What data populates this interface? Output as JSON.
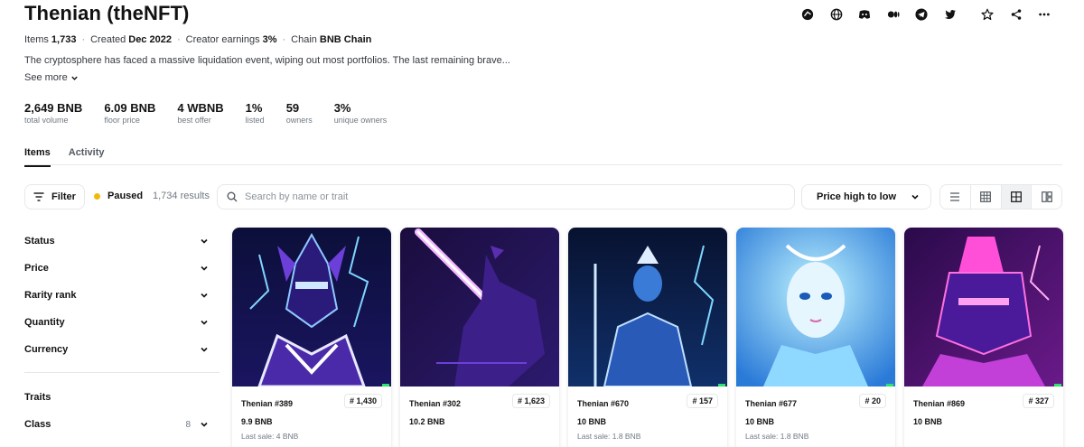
{
  "collection": {
    "title": "Thenian (theNFT)",
    "meta": [
      {
        "label": "Items",
        "value": "1,733"
      },
      {
        "label": "Created",
        "value": "Dec 2022"
      },
      {
        "label": "Creator earnings",
        "value": "3%"
      },
      {
        "label": "Chain",
        "value": "BNB Chain"
      }
    ],
    "description": "The cryptosphere has faced a massive liquidation event, wiping out most portfolios. The last remaining brave...",
    "see_more": "See more"
  },
  "social_icons": [
    "explorer-icon",
    "globe-icon",
    "discord-icon",
    "medium-icon",
    "telegram-icon",
    "twitter-icon",
    "star-icon",
    "share-icon",
    "more-icon"
  ],
  "stats": [
    {
      "value": "2,649 BNB",
      "label": "total volume"
    },
    {
      "value": "6.09 BNB",
      "label": "floor price"
    },
    {
      "value": "4 WBNB",
      "label": "best offer"
    },
    {
      "value": "1%",
      "label": "listed"
    },
    {
      "value": "59",
      "label": "owners"
    },
    {
      "value": "3%",
      "label": "unique owners"
    }
  ],
  "tabs": [
    "Items",
    "Activity"
  ],
  "toolbar": {
    "filter_label": "Filter",
    "status_label": "Paused",
    "results": "1,734 results",
    "search_placeholder": "Search by name or trait",
    "sort_label": "Price high to low",
    "view_icons": [
      "list-view-icon",
      "small-grid-icon",
      "large-grid-icon",
      "detail-view-icon"
    ]
  },
  "sidebar": {
    "filters": [
      "Status",
      "Price",
      "Rarity rank",
      "Quantity",
      "Currency"
    ],
    "traits_heading": "Traits",
    "traits": [
      {
        "label": "Class",
        "count": "8"
      }
    ]
  },
  "cards": [
    {
      "name": "Thenian #389",
      "rank": "# 1,430",
      "price": "9.9 BNB",
      "last_sale": "Last sale: 4 BNB"
    },
    {
      "name": "Thenian #302",
      "rank": "# 1,623",
      "price": "10.2 BNB",
      "last_sale": ""
    },
    {
      "name": "Thenian #670",
      "rank": "# 157",
      "price": "10 BNB",
      "last_sale": "Last sale: 1.8 BNB"
    },
    {
      "name": "Thenian #677",
      "rank": "# 20",
      "price": "10 BNB",
      "last_sale": "Last sale: 1.8 BNB"
    },
    {
      "name": "Thenian #869",
      "rank": "# 327",
      "price": "10 BNB",
      "last_sale": ""
    }
  ],
  "colors": {
    "status_dot": "#f0b90b",
    "text": "#121212",
    "muted": "#707a83"
  }
}
